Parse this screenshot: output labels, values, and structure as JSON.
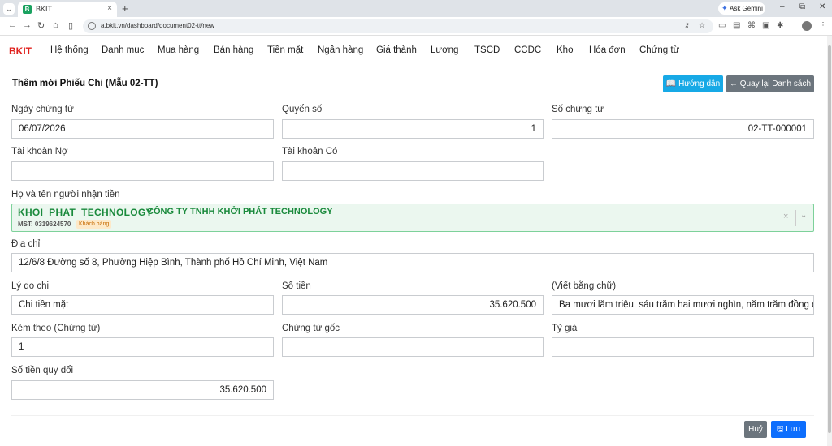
{
  "browser": {
    "tab_title": "BKIT",
    "tab_favicon": "B",
    "ask_gemini": "Ask Gemini",
    "url": "a.bkit.vn/dashboard/document02-tt/new"
  },
  "app": {
    "logo": "BKIT",
    "menu": [
      "Hệ thống",
      "Danh mục",
      "Mua hàng",
      "Bán hàng",
      "Tiền mặt",
      "Ngân hàng",
      "Giá thành",
      "Lương",
      "TSCĐ",
      "CCDC",
      "Kho",
      "Hóa đơn",
      "Chứng từ"
    ]
  },
  "form": {
    "title": "Thêm mới Phiếu Chi (Mẫu 02-TT)",
    "help_button": "Hướng dẫn",
    "back_button": "Quay lại Danh sách",
    "fields": {
      "ngay_chung_tu": {
        "label": "Ngày chứng từ",
        "value": "06/07/2026"
      },
      "quyen_so": {
        "label": "Quyển số",
        "value": "1"
      },
      "so_chung_tu": {
        "label": "Số chứng từ",
        "value": "02-TT-000001"
      },
      "tai_khoan_no": {
        "label": "Tài khoản Nợ",
        "value": ""
      },
      "tai_khoan_co": {
        "label": "Tài khoản Có",
        "value": ""
      },
      "dia_chi": {
        "label": "Địa chỉ",
        "value": "12/6/8 Đường số 8, Phường Hiệp Bình, Thành phố Hồ Chí Minh, Việt Nam"
      },
      "ly_do_chi": {
        "label": "Lý do chi",
        "value": "Chi tiền mặt"
      },
      "so_tien": {
        "label": "Số tiền",
        "value": "35.620.500"
      },
      "viet_bang_chu": {
        "label": "(Viết bằng chữ)",
        "value": "Ba mươi lăm triệu, sáu trăm hai mươi nghìn, năm trăm đồng chẵn"
      },
      "kem_theo": {
        "label": "Kèm theo (Chứng từ)",
        "value": "1"
      },
      "chung_tu_goc": {
        "label": "Chứng từ gốc",
        "value": ""
      },
      "ty_gia": {
        "label": "Tỷ giá",
        "value": ""
      },
      "so_tien_quy_doi": {
        "label": "Số tiền quy đổi",
        "value": "35.620.500"
      }
    },
    "payee": {
      "label": "Họ và tên người nhận tiền",
      "code": "KHOI_PHAT_TECHNOLOGY",
      "name": "CÔNG TY TNHH KHỞI PHÁT TECHNOLOGY",
      "tax_id": "MST: 0319624570",
      "badge": "Khách hàng"
    },
    "cancel_button": "Huỷ",
    "save_button": "Lưu"
  },
  "colors": {
    "brand": "#e0201c",
    "help": "#17a9e6",
    "secondary": "#6c757d",
    "primary": "#0d6efd",
    "payee_green": "#1a8a3c"
  }
}
